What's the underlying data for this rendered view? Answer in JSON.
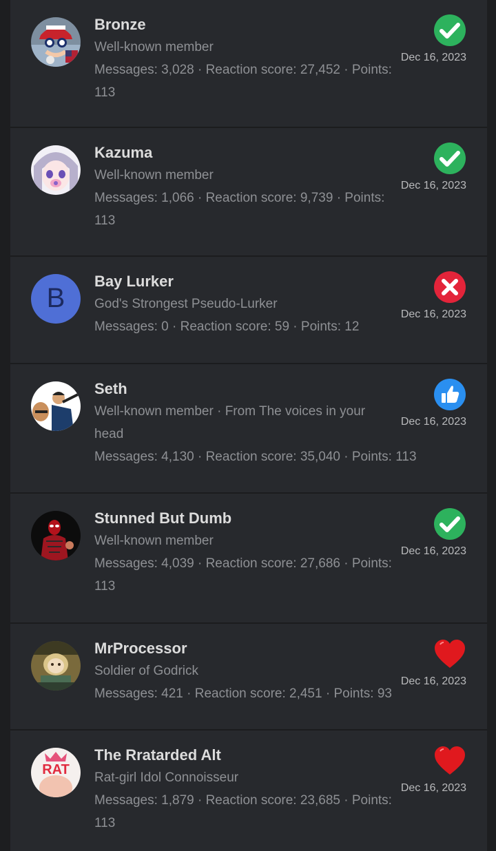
{
  "reactions_list": [
    {
      "name": "Bronze",
      "title": "Well-known member",
      "stats_line1": "Messages: 3,028 · Reaction score: 27,452 · Points:",
      "stats_line2": "113",
      "date": "Dec 16, 2023",
      "reaction": "like-check-icon"
    },
    {
      "name": "Kazuma",
      "title": "Well-known member",
      "stats_line1": "Messages: 1,066 · Reaction score: 9,739 · Points:",
      "stats_line2": "113",
      "date": "Dec 16, 2023",
      "reaction": "like-check-icon"
    },
    {
      "name": "Bay Lurker",
      "title": "God's Strongest Pseudo-Lurker",
      "stats_line1": "Messages: 0 · Reaction score: 59 · Points: 12",
      "date": "Dec 16, 2023",
      "reaction": "dislike-x-icon",
      "avatar_letter": "B"
    },
    {
      "name": "Seth",
      "title": "Well-known member · From The voices in your",
      "title_line2": "head",
      "stats_line1": "Messages: 4,130 · Reaction score: 35,040 · Points: 113",
      "date": "Dec 16, 2023",
      "reaction": "thumbs-up-icon"
    },
    {
      "name": "Stunned But Dumb",
      "title": "Well-known member",
      "stats_line1": "Messages: 4,039 · Reaction score: 27,686 · Points:",
      "stats_line2": "113",
      "date": "Dec 16, 2023",
      "reaction": "like-check-icon"
    },
    {
      "name": "MrProcessor",
      "title": "Soldier of Godrick",
      "stats_line1": "Messages: 421 · Reaction score: 2,451 · Points: 93",
      "date": "Dec 16, 2023",
      "reaction": "heart-icon"
    },
    {
      "name": "The Rratarded Alt",
      "title": "Rat-girl Idol Connoisseur",
      "stats_line1": "Messages: 1,879 · Reaction score: 23,685 · Points:",
      "stats_line2": "113",
      "date": "Dec 16, 2023",
      "reaction": "heart-icon",
      "avatar_text": "RAT"
    }
  ],
  "colors": {
    "background": "#1d1e20",
    "row": "#27292d",
    "username": "#dcdcdc",
    "meta": "#8e9094",
    "check_green": "#2db25d",
    "x_red": "#e3243a",
    "thumb_blue": "#2a8ff0",
    "heart_red": "#e0191e",
    "letter_avatar": "#4f6fd6"
  }
}
